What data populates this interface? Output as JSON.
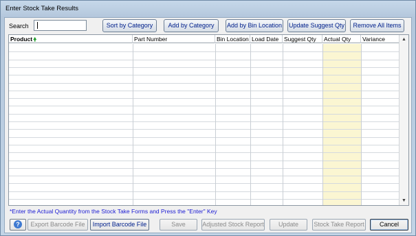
{
  "window": {
    "title": "Enter Stock Take Results"
  },
  "search": {
    "label": "Search",
    "value": ""
  },
  "toolbar": {
    "sort_by_category": "Sort by Category",
    "add_by_category": "Add by Category",
    "add_by_bin_location": "Add by Bin Location",
    "update_suggest_qty": "Update Suggest Qty",
    "remove_all_items": "Remove All Items"
  },
  "grid": {
    "columns": [
      "Product",
      "Part Number",
      "Bin Location",
      "Load Date",
      "Suggest Qty",
      "Actual Qty",
      "Variance"
    ],
    "sorted_column": "Product",
    "sort_direction": "ascending",
    "rows": [],
    "highlight_column_color": "#fbf6d2"
  },
  "hint": "*Enter the Actual Quantity from the Stock Take Forms and Press the \"Enter\" Key",
  "bottom": {
    "help_icon": "help-icon",
    "export_barcode_file": "Export Barcode File",
    "import_barcode_file": "Import Barcode File",
    "save": "Save",
    "adjusted_stock_report": "Adjusted Stock Report",
    "update": "Update",
    "stock_take_report": "Stock Take Report",
    "cancel": "Cancel"
  },
  "colors": {
    "link_text": "#00208c",
    "hint_text": "#1b1bd4",
    "sort_arrow": "#1d9a2b"
  }
}
